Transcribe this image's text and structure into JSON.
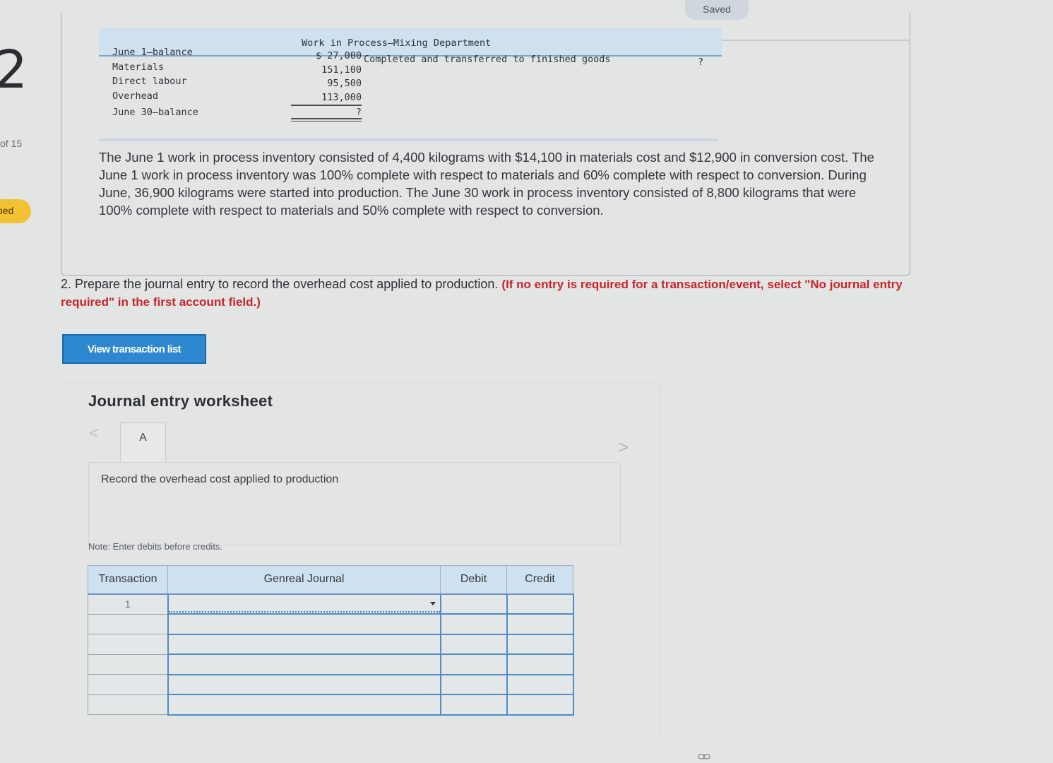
{
  "sidebar": {
    "question_number": "2",
    "of_count": "of 15",
    "flag_label": "ped"
  },
  "status": {
    "saved": "Saved"
  },
  "t_account": {
    "title": "Work in Process–Mixing Department",
    "left_labels": [
      "June 1–balance",
      "Materials",
      "Direct labour",
      "Overhead",
      "June 30–balance"
    ],
    "left_values": [
      "$ 27,000",
      "151,100",
      "95,500",
      "113,000",
      "?"
    ],
    "right_label": "Completed and transferred to finished goods",
    "right_value": "?"
  },
  "problem_text": "The June 1 work in process inventory consisted of 4,400 kilograms with $14,100 in materials cost and $12,900 in conversion cost. The June 1 work in process inventory was 100% complete with respect to materials and 60% complete with respect to conversion. During June, 36,900 kilograms were started into production. The June 30 work in process inventory consisted of 8,800 kilograms that were 100% complete with respect to materials and 50% complete with respect to conversion.",
  "question": {
    "text": "2. Prepare the journal entry to record the overhead cost applied to production.",
    "instruction": "(If no entry is required for a transaction/event, select \"No journal entry required\" in the first account field.)"
  },
  "buttons": {
    "view_transaction_list": "View transaction list"
  },
  "worksheet": {
    "title": "Journal entry worksheet",
    "tab_label": "A",
    "nav_prev": "<",
    "nav_next": ">",
    "record_text": "Record the overhead cost applied to production",
    "note": "Note: Enter debits before credits."
  },
  "journal_table": {
    "headers": {
      "transaction": "Transaction",
      "general_journal": "Genreal Journal",
      "debit": "Debit",
      "credit": "Credit"
    },
    "rows": [
      {
        "transaction": "1",
        "account": "",
        "debit": "",
        "credit": ""
      },
      {
        "transaction": "",
        "account": "",
        "debit": "",
        "credit": ""
      },
      {
        "transaction": "",
        "account": "",
        "debit": "",
        "credit": ""
      },
      {
        "transaction": "",
        "account": "",
        "debit": "",
        "credit": ""
      },
      {
        "transaction": "",
        "account": "",
        "debit": "",
        "credit": ""
      },
      {
        "transaction": "",
        "account": "",
        "debit": "",
        "credit": ""
      }
    ]
  },
  "colors": {
    "accent_blue": "#2e88d0",
    "instruction_red": "#c8242a",
    "flag_yellow": "#f2c233"
  }
}
